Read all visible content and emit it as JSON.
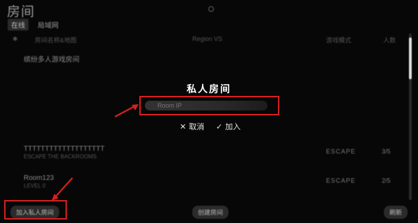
{
  "window": {
    "title": "房间"
  },
  "tabs": [
    {
      "label": "在线"
    },
    {
      "label": "局域网"
    }
  ],
  "table": {
    "headers": [
      "房间名称&地图",
      "Region VS",
      "游戏模式",
      "人数"
    ],
    "rows": [
      {
        "name": "缤纷多人游戏房间",
        "sub": "",
        "mode": "",
        "count": ""
      },
      {
        "name": "TTTTTTTTTTTTTTTTTTT",
        "sub": "ESCAPE THE BACKROOMS",
        "mode": "ESCAPE",
        "count": "3/5"
      },
      {
        "name": "Room123",
        "sub": "LEVEL 0",
        "mode": "ESCAPE",
        "count": "2/5"
      }
    ]
  },
  "modal": {
    "title": "私人房间",
    "ip_placeholder": "Room IP",
    "cancel_label": "取消",
    "join_label": "加入"
  },
  "bottom": {
    "private_button": "加入私人房间",
    "create_button": "创建房间",
    "refresh_button": "刷新"
  },
  "colors": {
    "highlight": "#d62020",
    "background": "#070707"
  }
}
